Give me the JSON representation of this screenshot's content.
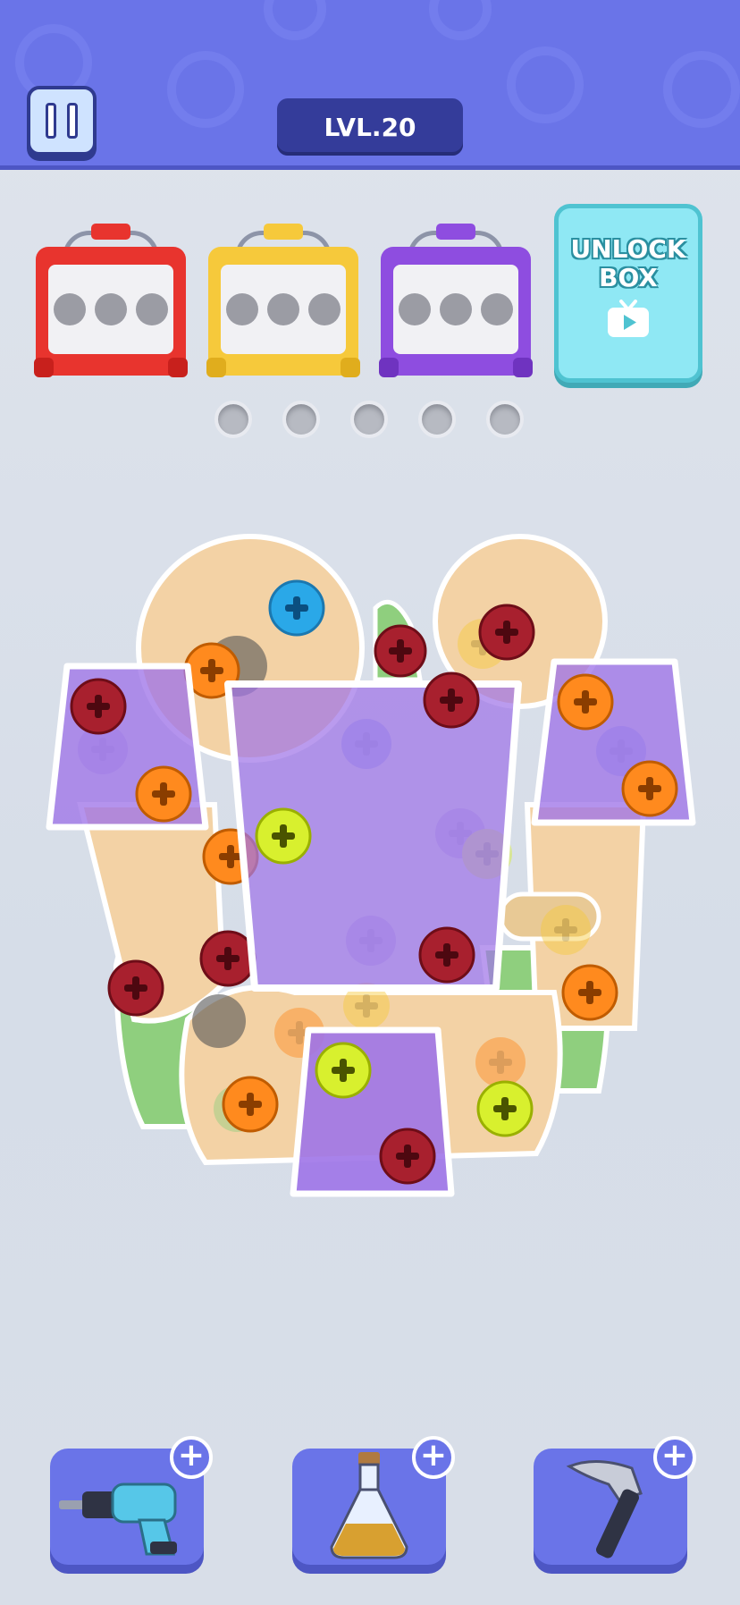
{
  "header": {
    "level_label": "LVL.20",
    "background_color": "#6a74e8"
  },
  "pause_button": {
    "icon": "pause-icon"
  },
  "boxes": [
    {
      "color": "red",
      "hex": "#e8342e",
      "filled_slots": 0,
      "total_slots": 3
    },
    {
      "color": "yellow",
      "hex": "#f6c93b",
      "filled_slots": 0,
      "total_slots": 3
    },
    {
      "color": "purple",
      "hex": "#8e4de0",
      "filled_slots": 0,
      "total_slots": 3
    }
  ],
  "unlock_box": {
    "line1": "UNLOCK",
    "line2": "BOX",
    "icon": "video-ad-icon"
  },
  "holding_holes": {
    "count": 5,
    "filled": 0
  },
  "tools": [
    {
      "name": "drill",
      "icon": "drill-icon"
    },
    {
      "name": "potion",
      "icon": "potion-icon"
    },
    {
      "name": "hammer",
      "icon": "hammer-icon"
    }
  ],
  "screw_colors": {
    "red": "#a8202e",
    "orange": "#ff8a1e",
    "yellow_green": "#d8f02e",
    "blue": "#2aa8e8",
    "lavender": "#9f8fe0"
  }
}
